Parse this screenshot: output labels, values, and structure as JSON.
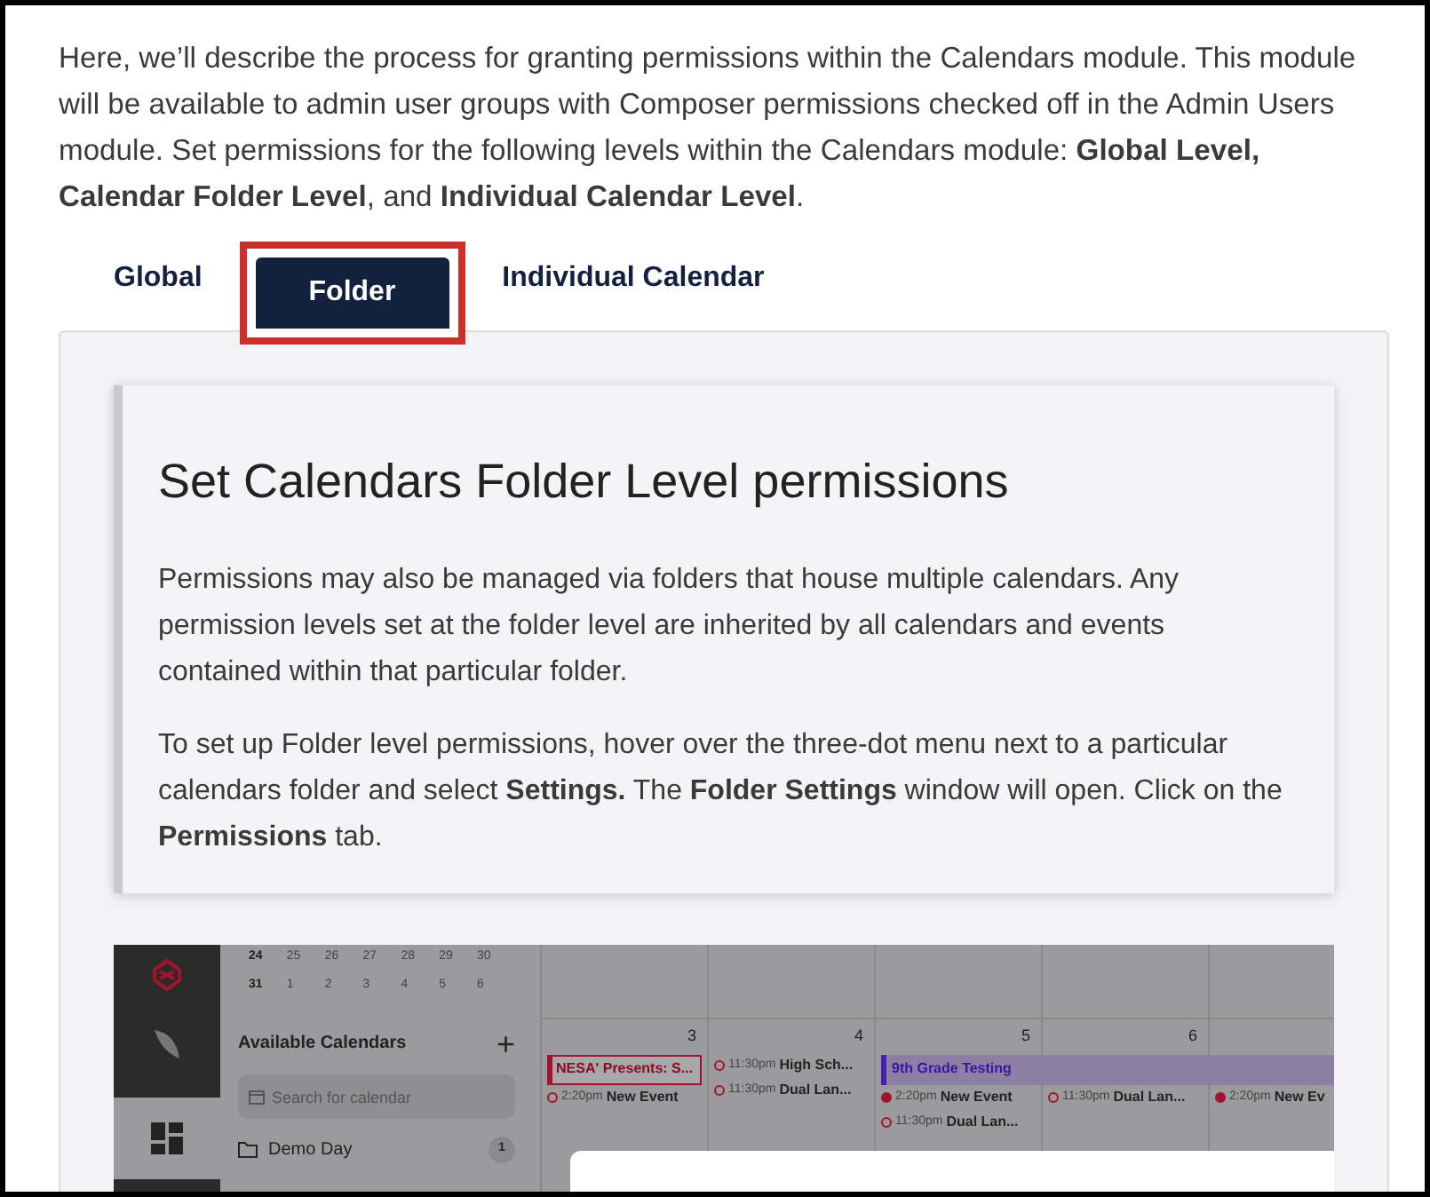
{
  "intro": "Here, we’ll describe the process for granting permissions within the Calendars module. This module will be available to admin user groups with Composer permissions checked off in the Admin Users module. Set permissions for the following levels within the Calendars module: **Global Level, Calendar Folder Level**, and **Individual Calendar Level**.",
  "tabs": [
    {
      "label": "Global",
      "selected": false,
      "highlighted": false
    },
    {
      "label": "Folder",
      "selected": true,
      "highlighted": true
    },
    {
      "label": "Individual Calendar",
      "selected": false,
      "highlighted": false
    }
  ],
  "card": {
    "heading": "Set Calendars Folder Level permissions",
    "paragraphs": [
      "Permissions may also be managed via folders that house multiple calendars. Any permission levels set at the folder level are inherited by all calendars and events contained within that particular folder.",
      "To set up Folder level permissions, hover over the three-dot menu next to a particular calendars folder and select **Settings.** The **Folder Settings** window will open. Click on the **Permissions** tab."
    ]
  },
  "screenshot": {
    "mini_calendar": [
      [
        "24",
        "25",
        "26",
        "27",
        "28",
        "29",
        "30"
      ],
      [
        "31",
        "1",
        "2",
        "3",
        "4",
        "5",
        "6"
      ]
    ],
    "calendars_title": "Available Calendars",
    "add_label": "+",
    "search_placeholder": "Search for calendar",
    "folders": [
      {
        "name": "Demo Day",
        "count": "1"
      }
    ],
    "days": [
      {
        "number": "3",
        "events": [
          {
            "kind": "banner",
            "title": "NESA' Presents: S..."
          },
          {
            "kind": "timed",
            "filled": false,
            "time": "2:20pm",
            "title": "New Event"
          }
        ]
      },
      {
        "number": "4",
        "events": [
          {
            "kind": "timed",
            "filled": false,
            "time": "11:30pm",
            "title": "High Sch..."
          },
          {
            "kind": "timed",
            "filled": false,
            "time": "11:30pm",
            "title": "Dual Lan..."
          }
        ]
      },
      {
        "number": "5",
        "events": [
          {
            "kind": "span",
            "title": "9th Grade Testing"
          },
          {
            "kind": "timed",
            "filled": true,
            "time": "2:20pm",
            "title": "New Event"
          },
          {
            "kind": "timed",
            "filled": false,
            "time": "11:30pm",
            "title": "Dual Lan..."
          }
        ]
      },
      {
        "number": "6",
        "events": [
          {
            "kind": "spacer"
          },
          {
            "kind": "timed",
            "filled": false,
            "time": "11:30pm",
            "title": "Dual Lan..."
          }
        ]
      },
      {
        "events": [
          {
            "kind": "spacer"
          },
          {
            "kind": "timed",
            "filled": true,
            "time": "2:20pm",
            "title": "New Ev"
          }
        ]
      }
    ]
  }
}
